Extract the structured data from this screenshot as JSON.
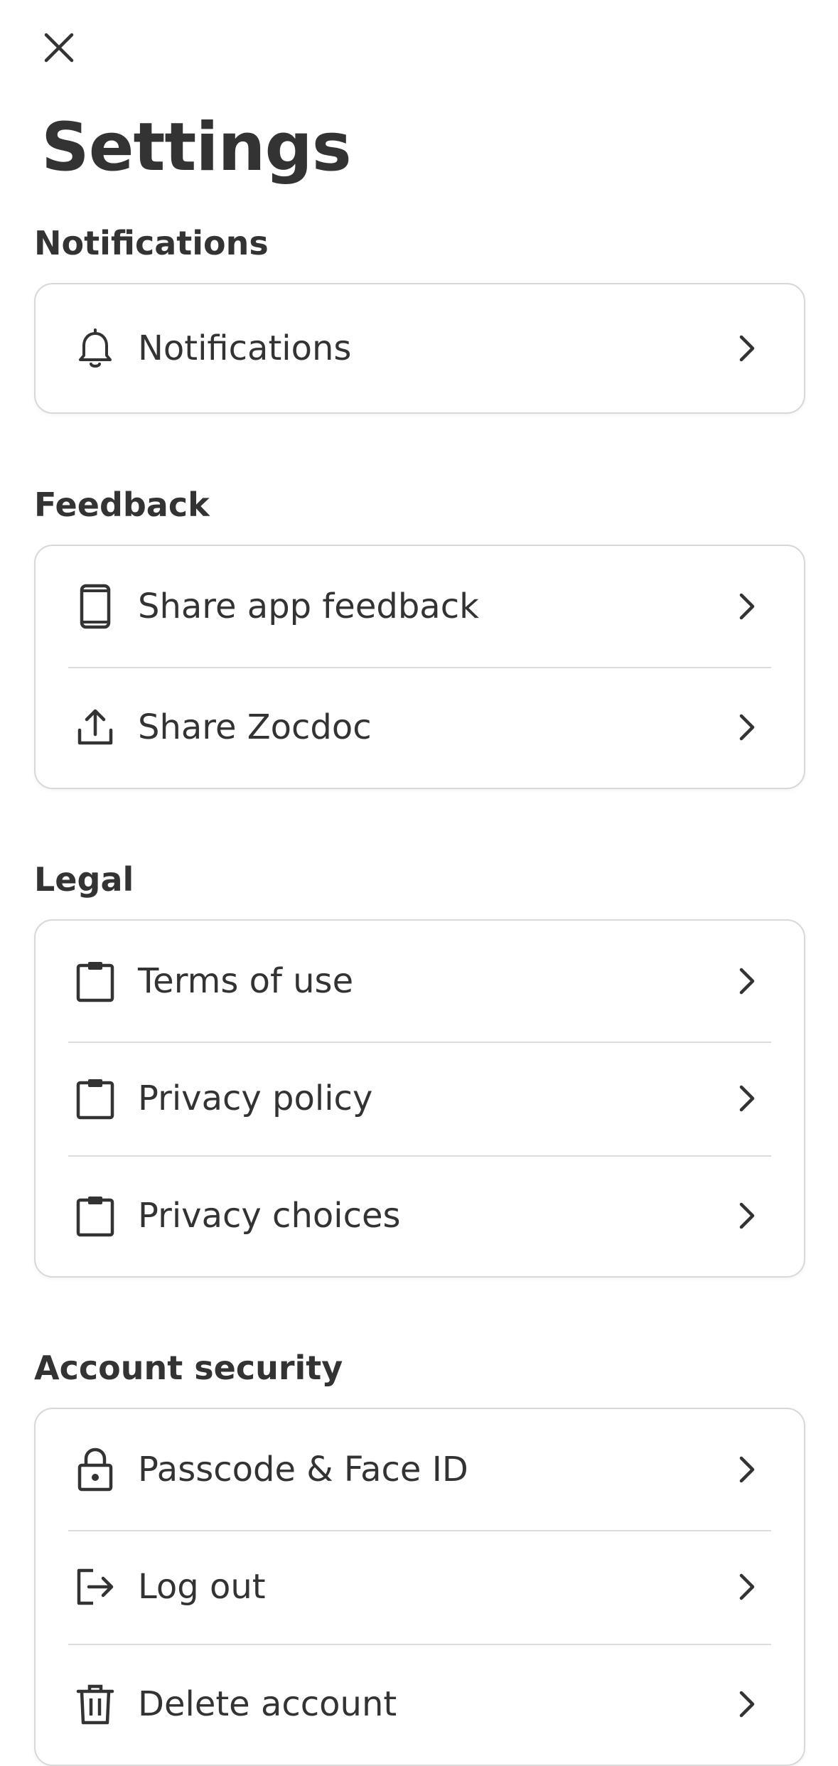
{
  "header": {
    "title": "Settings",
    "close_icon": "close-icon"
  },
  "sections": [
    {
      "heading": "Notifications",
      "items": [
        {
          "label": "Notifications",
          "icon": "bell-icon"
        }
      ]
    },
    {
      "heading": "Feedback",
      "items": [
        {
          "label": "Share app feedback",
          "icon": "phone-icon"
        },
        {
          "label": "Share Zocdoc",
          "icon": "share-upload-icon"
        }
      ]
    },
    {
      "heading": "Legal",
      "items": [
        {
          "label": "Terms of use",
          "icon": "clipboard-icon"
        },
        {
          "label": "Privacy policy",
          "icon": "clipboard-icon"
        },
        {
          "label": "Privacy choices",
          "icon": "clipboard-icon"
        }
      ]
    },
    {
      "heading": "Account security",
      "items": [
        {
          "label": "Passcode & Face ID",
          "icon": "lock-icon"
        },
        {
          "label": "Log out",
          "icon": "logout-icon"
        },
        {
          "label": "Delete account",
          "icon": "trash-icon"
        }
      ]
    }
  ],
  "colors": {
    "text": "#333333",
    "border": "#d8d8d8",
    "divider": "#dcdcdc",
    "background": "#ffffff"
  }
}
